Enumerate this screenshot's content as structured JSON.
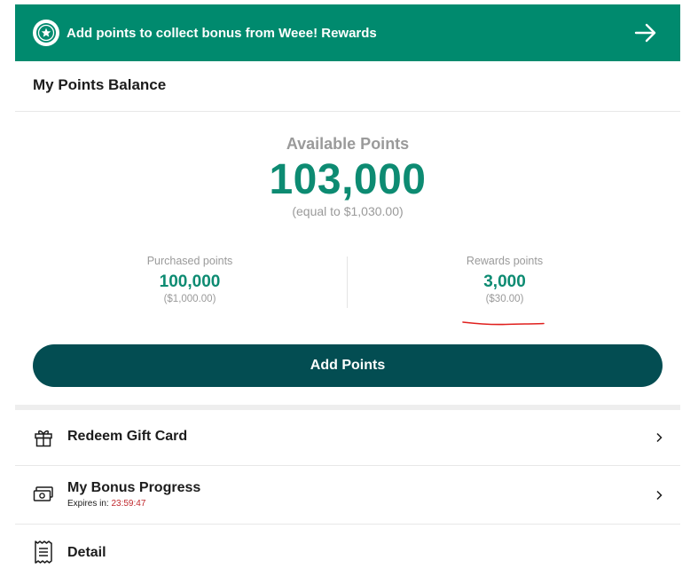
{
  "banner": {
    "text": "Add points to collect bonus from Weee! Rewards",
    "badge_icon": "star-badge-icon",
    "arrow_icon": "arrow-right-icon",
    "color": "#008a6e"
  },
  "balance": {
    "title": "My Points Balance"
  },
  "available": {
    "label": "Available Points",
    "value": "103,000",
    "equivalent": "(equal to $1,030.00)"
  },
  "purchased": {
    "label": "Purchased points",
    "value": "100,000",
    "equivalent": "($1,000.00)"
  },
  "rewards": {
    "label": "Rewards points",
    "value": "3,000",
    "equivalent": "($30.00)"
  },
  "add_points": {
    "label": "Add Points",
    "color": "#034d52"
  },
  "menu": {
    "redeem": {
      "label": "Redeem Gift Card",
      "icon": "gift-icon"
    },
    "bonus": {
      "label": "My Bonus Progress",
      "icon": "money-icon",
      "expires_prefix": "Expires in:",
      "expires_time": "23:59:47"
    },
    "detail": {
      "label": "Detail",
      "icon": "receipt-icon"
    }
  },
  "accent_color": "#0d8b72",
  "annotation_color": "#e0201e"
}
